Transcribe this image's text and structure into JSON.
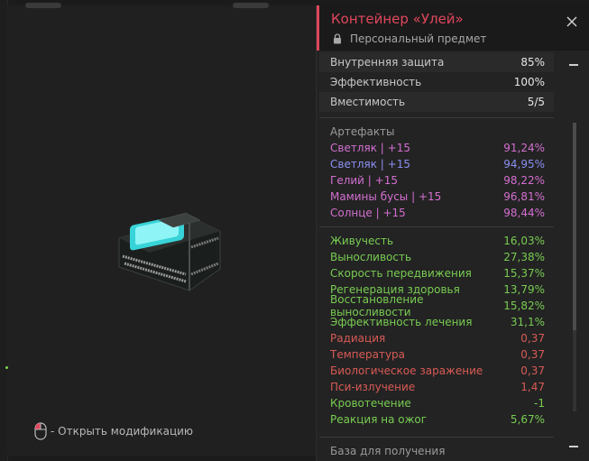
{
  "viewer": {
    "hint_text": "- Открыть модификацию",
    "chest_icon": "container-hive-model",
    "mouse_icon": "mouse-icon"
  },
  "panel": {
    "title": "Контейнер «Улей»",
    "subtitle": "Персональный предмет",
    "close_icon": "close-icon",
    "lock_icon": "lock-icon",
    "accent_color": "#e0475c",
    "base_stats": [
      {
        "label": "Внутренняя защита",
        "value": "85%"
      },
      {
        "label": "Эффективность",
        "value": "100%"
      },
      {
        "label": "Вместимость",
        "value": "5/5"
      }
    ],
    "artifacts_title": "Артефакты",
    "artifacts": [
      {
        "label": "Светляк | +15",
        "value": "91,24%",
        "color": "pink"
      },
      {
        "label": "Светляк | +15",
        "value": "94,95%",
        "color": "blue"
      },
      {
        "label": "Гелий | +15",
        "value": "98,22%",
        "color": "pink"
      },
      {
        "label": "Мамины бусы | +15",
        "value": "96,81%",
        "color": "pink"
      },
      {
        "label": "Солнце | +15",
        "value": "98,44%",
        "color": "pink"
      }
    ],
    "effects": [
      {
        "label": "Живучесть",
        "value": "16,03%",
        "color": "green"
      },
      {
        "label": "Выносливость",
        "value": "27,38%",
        "color": "green"
      },
      {
        "label": "Скорость передвижения",
        "value": "15,37%",
        "color": "green"
      },
      {
        "label": "Регенерация здоровья",
        "value": "13,79%",
        "color": "green"
      },
      {
        "label": "Восстановление выносливости",
        "value": "15,82%",
        "color": "green"
      },
      {
        "label": "Эффективность лечения",
        "value": "31,1%",
        "color": "green"
      },
      {
        "label": "Радиация",
        "value": "0,37",
        "color": "red"
      },
      {
        "label": "Температура",
        "value": "0,37",
        "color": "red"
      },
      {
        "label": "Биологическое заражение",
        "value": "0,37",
        "color": "red"
      },
      {
        "label": "Пси-излучение",
        "value": "1,47",
        "color": "red"
      },
      {
        "label": "Кровотечение",
        "value": "-1",
        "color": "green"
      },
      {
        "label": "Реакция на ожог",
        "value": "5,67%",
        "color": "green"
      }
    ],
    "footer_title": "База для получения"
  }
}
